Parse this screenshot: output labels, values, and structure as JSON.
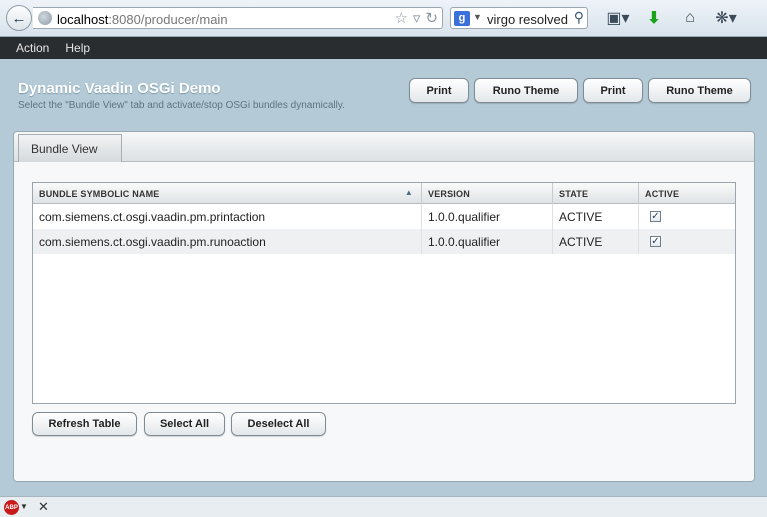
{
  "browser": {
    "url_host": "localhost",
    "url_path": ":8080/producer/main",
    "search_engine_glyph": "g",
    "search_query": "virgo resolved b",
    "icons": [
      "back-arrow-icon",
      "globe-icon",
      "star-icon",
      "dropdown-icon",
      "reload-icon",
      "google-icon",
      "magnifier-icon",
      "bookmark-icon",
      "download-icon",
      "home-icon",
      "addon-icon"
    ]
  },
  "menu": {
    "items": [
      "Action",
      "Help"
    ]
  },
  "header": {
    "title": "Dynamic Vaadin OSGi Demo",
    "subtitle": "Select the \"Bundle View\" tab and activate/stop OSGi bundles dynamically.",
    "buttons": [
      "Print",
      "Runo Theme",
      "Print",
      "Runo Theme"
    ]
  },
  "tabs": [
    "Bundle View"
  ],
  "table": {
    "columns": [
      "BUNDLE SYMBOLIC NAME",
      "VERSION",
      "STATE",
      "ACTIVE"
    ],
    "sorted_column": "BUNDLE SYMBOLIC NAME",
    "sort_direction": "ascending",
    "rows": [
      {
        "name": "com.siemens.ct.osgi.vaadin.pm.printaction",
        "version": "1.0.0.qualifier",
        "state": "ACTIVE",
        "active": true
      },
      {
        "name": "com.siemens.ct.osgi.vaadin.pm.runoaction",
        "version": "1.0.0.qualifier",
        "state": "ACTIVE",
        "active": true
      }
    ]
  },
  "actions": {
    "refresh": "Refresh Table",
    "select_all": "Select All",
    "deselect_all": "Deselect All"
  },
  "statusbar": {
    "abp_label": "ABP"
  },
  "colors": {
    "background": "#b4cad6",
    "menubar": "#2a2d30",
    "download_green": "#1aa31a",
    "abp_red": "#c81a1a"
  }
}
